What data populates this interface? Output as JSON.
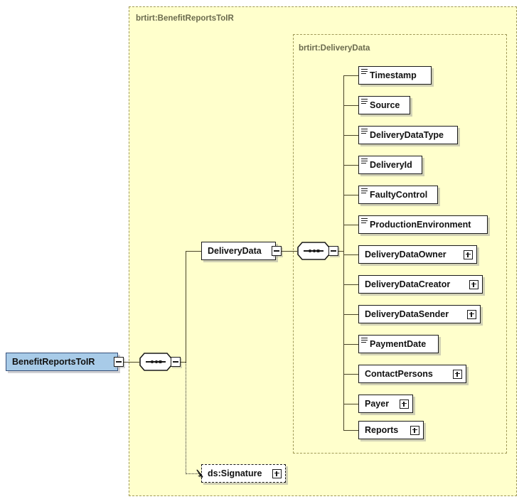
{
  "diagram": {
    "type": "xml-schema-element-tree",
    "colors": {
      "container_fill": "#ffffcc",
      "container_border": "#a09a58",
      "root_node_fill": "#a8cbe8",
      "node_fill": "#ffffff",
      "line": "#4a4528",
      "text": "#111111",
      "label_text": "#6b6b4e"
    },
    "containers": [
      {
        "id": "outer",
        "label": "brtirt:BenefitReportsToIR"
      },
      {
        "id": "inner",
        "label": "brtirt:DeliveryData"
      }
    ],
    "root": {
      "label": "BenefitReportsToIR",
      "expander": "minus"
    },
    "compositors": [
      {
        "id": "root-sequence",
        "kind": "sequence",
        "expander": "minus"
      },
      {
        "id": "deliverydata-sequence",
        "kind": "sequence",
        "expander": "minus"
      }
    ],
    "branch": {
      "label": "DeliveryData",
      "expander": "minus"
    },
    "optional": {
      "label": "ds:Signature",
      "expander": "plus",
      "style": "dashed"
    },
    "children": [
      {
        "label": "Timestamp",
        "glyph": "sequence-glyph",
        "expander": null
      },
      {
        "label": "Source",
        "glyph": "sequence-glyph",
        "expander": null
      },
      {
        "label": "DeliveryDataType",
        "glyph": "sequence-glyph",
        "expander": null
      },
      {
        "label": "DeliveryId",
        "glyph": "sequence-glyph",
        "expander": null
      },
      {
        "label": "FaultyControl",
        "glyph": "sequence-glyph",
        "expander": null
      },
      {
        "label": "ProductionEnvironment",
        "glyph": "sequence-glyph",
        "expander": null
      },
      {
        "label": "DeliveryDataOwner",
        "glyph": null,
        "expander": "plus"
      },
      {
        "label": "DeliveryDataCreator",
        "glyph": null,
        "expander": "plus"
      },
      {
        "label": "DeliveryDataSender",
        "glyph": null,
        "expander": "plus"
      },
      {
        "label": "PaymentDate",
        "glyph": "sequence-glyph",
        "expander": null
      },
      {
        "label": "ContactPersons",
        "glyph": null,
        "expander": "plus"
      },
      {
        "label": "Payer",
        "glyph": null,
        "expander": "plus"
      },
      {
        "label": "Reports",
        "glyph": null,
        "expander": "plus"
      }
    ]
  }
}
